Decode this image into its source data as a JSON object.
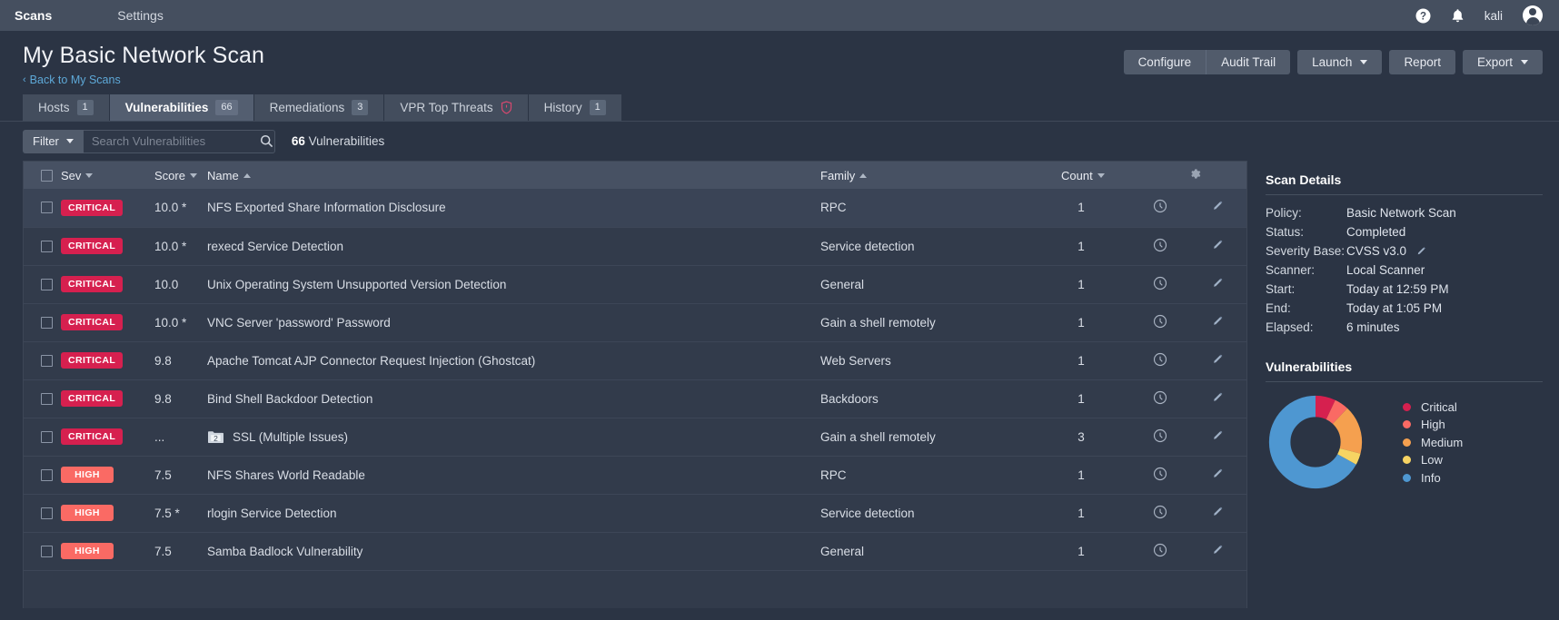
{
  "topnav": {
    "links": [
      {
        "label": "Scans",
        "active": true
      },
      {
        "label": "Settings",
        "active": false
      }
    ],
    "help_icon": "help-circle-icon",
    "bell_icon": "notification-bell-icon",
    "username": "kali",
    "avatar_icon": "user-avatar-icon"
  },
  "header": {
    "title": "My Basic Network Scan",
    "back_label": "Back to My Scans",
    "back_chevron": "‹",
    "buttons": {
      "configure": "Configure",
      "audit_trail": "Audit Trail",
      "launch": "Launch",
      "report": "Report",
      "export": "Export"
    }
  },
  "tabs": [
    {
      "label": "Hosts",
      "badge": "1",
      "active": false,
      "icon": null
    },
    {
      "label": "Vulnerabilities",
      "badge": "66",
      "active": true,
      "icon": null
    },
    {
      "label": "Remediations",
      "badge": "3",
      "active": false,
      "icon": null
    },
    {
      "label": "VPR Top Threats",
      "badge": null,
      "active": false,
      "icon": "shield-icon"
    },
    {
      "label": "History",
      "badge": "1",
      "active": false,
      "icon": null
    }
  ],
  "filter_bar": {
    "filter_label": "Filter",
    "search_placeholder": "Search Vulnerabilities",
    "search_value": "",
    "search_icon": "search-icon",
    "count_number": "66",
    "count_suffix": " Vulnerabilities"
  },
  "table": {
    "columns": [
      {
        "key": "checkbox",
        "label": "",
        "sort": null
      },
      {
        "key": "sev",
        "label": "Sev",
        "sort": "desc"
      },
      {
        "key": "score",
        "label": "Score",
        "sort": "desc"
      },
      {
        "key": "name",
        "label": "Name",
        "sort": "asc"
      },
      {
        "key": "family",
        "label": "Family",
        "sort": "asc"
      },
      {
        "key": "count",
        "label": "Count",
        "sort": "desc"
      },
      {
        "key": "actions",
        "label": "",
        "sort": null
      },
      {
        "key": "gear",
        "label": "",
        "sort": null
      }
    ],
    "gear_icon": "gear-icon",
    "row_action_icons": [
      "clock-check-icon",
      "pencil-edit-icon"
    ],
    "rows": [
      {
        "sev": "CRITICAL",
        "sev_class": "critical",
        "score": "10.0 *",
        "name": "NFS Exported Share Information Disclosure",
        "family": "RPC",
        "count": "1",
        "folder": null,
        "highlight": true
      },
      {
        "sev": "CRITICAL",
        "sev_class": "critical",
        "score": "10.0 *",
        "name": "rexecd Service Detection",
        "family": "Service detection",
        "count": "1",
        "folder": null,
        "highlight": false
      },
      {
        "sev": "CRITICAL",
        "sev_class": "critical",
        "score": "10.0",
        "name": "Unix Operating System Unsupported Version Detection",
        "family": "General",
        "count": "1",
        "folder": null,
        "highlight": false
      },
      {
        "sev": "CRITICAL",
        "sev_class": "critical",
        "score": "10.0 *",
        "name": "VNC Server 'password' Password",
        "family": "Gain a shell remotely",
        "count": "1",
        "folder": null,
        "highlight": false
      },
      {
        "sev": "CRITICAL",
        "sev_class": "critical",
        "score": "9.8",
        "name": "Apache Tomcat AJP Connector Request Injection (Ghostcat)",
        "family": "Web Servers",
        "count": "1",
        "folder": null,
        "highlight": false
      },
      {
        "sev": "CRITICAL",
        "sev_class": "critical",
        "score": "9.8",
        "name": "Bind Shell Backdoor Detection",
        "family": "Backdoors",
        "count": "1",
        "folder": null,
        "highlight": false
      },
      {
        "sev": "CRITICAL",
        "sev_class": "critical",
        "score": "...",
        "name": "SSL (Multiple Issues)",
        "family": "Gain a shell remotely",
        "count": "3",
        "folder": "2",
        "highlight": false
      },
      {
        "sev": "HIGH",
        "sev_class": "high",
        "score": "7.5",
        "name": "NFS Shares World Readable",
        "family": "RPC",
        "count": "1",
        "folder": null,
        "highlight": false
      },
      {
        "sev": "HIGH",
        "sev_class": "high",
        "score": "7.5 *",
        "name": "rlogin Service Detection",
        "family": "Service detection",
        "count": "1",
        "folder": null,
        "highlight": false
      },
      {
        "sev": "HIGH",
        "sev_class": "high",
        "score": "7.5",
        "name": "Samba Badlock Vulnerability",
        "family": "General",
        "count": "1",
        "folder": null,
        "highlight": false
      }
    ]
  },
  "scan_details": {
    "heading": "Scan Details",
    "rows": [
      {
        "label": "Policy:",
        "value": "Basic Network Scan",
        "edit": false
      },
      {
        "label": "Status:",
        "value": "Completed",
        "edit": false
      },
      {
        "label": "Severity Base:",
        "value": "CVSS v3.0",
        "edit": true
      },
      {
        "label": "Scanner:",
        "value": "Local Scanner",
        "edit": false
      },
      {
        "label": "Start:",
        "value": "Today at 12:59 PM",
        "edit": false
      },
      {
        "label": "End:",
        "value": "Today at 1:05 PM",
        "edit": false
      },
      {
        "label": "Elapsed:",
        "value": "6 minutes",
        "edit": false
      }
    ],
    "edit_icon": "pencil-edit-icon"
  },
  "vulnerabilities_panel": {
    "heading": "Vulnerabilities"
  },
  "chart_data": {
    "type": "pie",
    "title": "Vulnerabilities",
    "subtype": "donut",
    "legend_position": "right",
    "categories": [
      "Critical",
      "High",
      "Medium",
      "Low",
      "Info"
    ],
    "values": [
      7,
      5,
      17,
      4,
      67
    ],
    "unit": "percent",
    "colors": [
      "#d6204f",
      "#fa6a64",
      "#f5a04f",
      "#f7d463",
      "#4e97d1"
    ]
  },
  "colors": {
    "accent_link": "#5ea9d8",
    "critical": "#d6204f",
    "high": "#fa6a64",
    "medium": "#f5a04f",
    "low": "#f7d463",
    "info": "#4e97d1",
    "topnav_bg": "#454f5f",
    "page_bg": "#2b3444",
    "table_bg": "#323b4b",
    "table_header_bg": "#475163"
  }
}
